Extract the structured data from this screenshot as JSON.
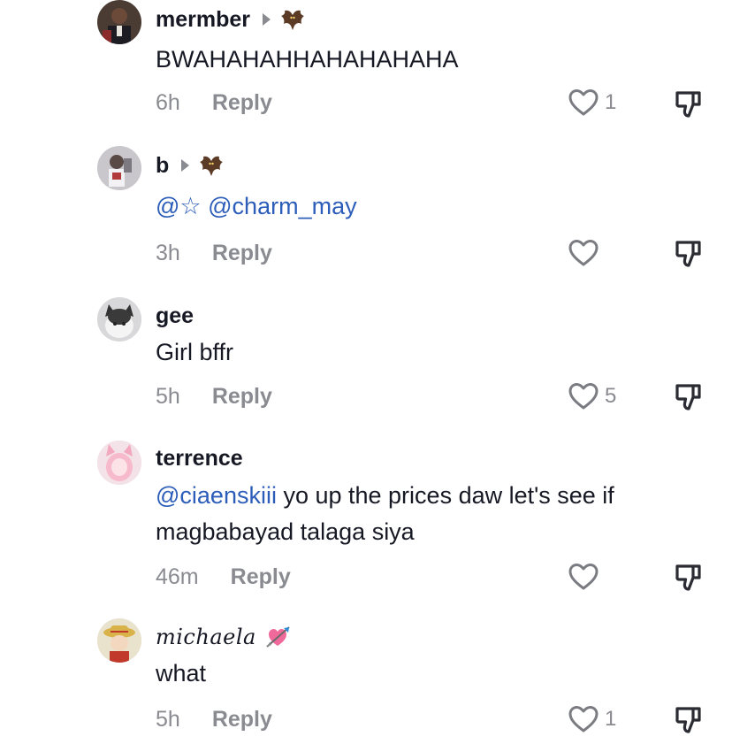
{
  "comments": [
    {
      "username": "mermber",
      "text": "BWAHAHAHHAHAHAHAHA",
      "time": "6h",
      "reply_label": "Reply",
      "likes": "1",
      "has_arrow": true,
      "badge": "bat-emoji-icon"
    },
    {
      "username": "b",
      "mention1": "@☆",
      "mention2": "@charm_may",
      "time": "3h",
      "reply_label": "Reply",
      "likes": "",
      "has_arrow": true,
      "badge": "bat-emoji-icon"
    },
    {
      "username": "gee",
      "text": "Girl bffr",
      "time": "5h",
      "reply_label": "Reply",
      "likes": "5"
    },
    {
      "username": "terrence",
      "mention": "@ciaenskiii",
      "text_line1": " yo up the prices daw let's see if",
      "text_line2": "magbabayad talaga siya",
      "time": "46m",
      "reply_label": "Reply",
      "likes": ""
    },
    {
      "username": "michaela",
      "badge": "heart-arrow-emoji-icon",
      "text": "what",
      "time": "5h",
      "reply_label": "Reply",
      "likes": "1"
    }
  ],
  "colors": {
    "mention": "#2b5db9",
    "meta_gray": "#8a8b91",
    "text": "#161823"
  }
}
